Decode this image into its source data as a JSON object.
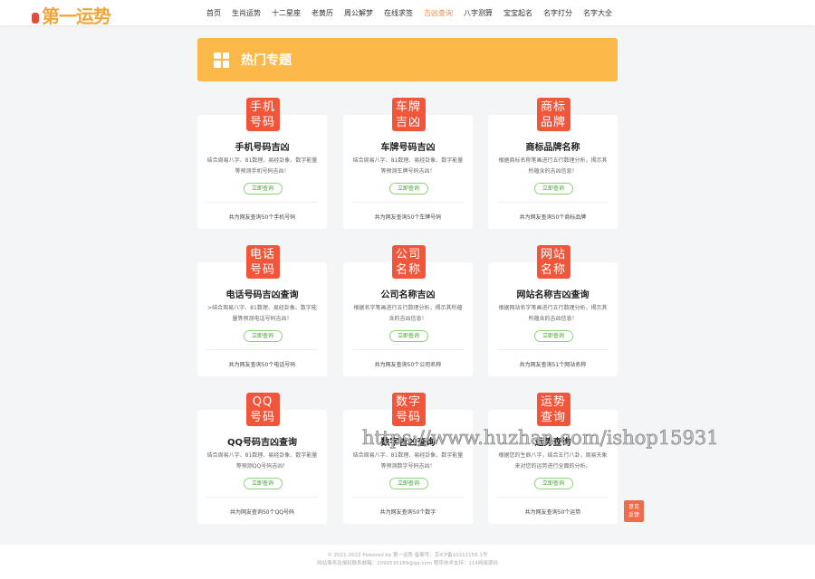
{
  "header": {
    "logo": "第一运势",
    "nav": [
      "首页",
      "生肖运势",
      "十二星座",
      "老黄历",
      "周公解梦",
      "在线求签",
      "吉凶查询",
      "八字测算",
      "宝宝起名",
      "名字打分",
      "名字大全"
    ],
    "active_index": 6
  },
  "banner": {
    "title": "热门专题"
  },
  "cards": [
    {
      "badge": [
        "手机",
        "号码"
      ],
      "title": "手机号码吉凶",
      "desc": "结合周易八字、81数理、易经卦象、数字能量等预测手机号码吉凶！",
      "button": "立即查询",
      "count": "共为网友查询50个手机号码"
    },
    {
      "badge": [
        "车牌",
        "吉凶"
      ],
      "title": "车牌号码吉凶",
      "desc": "结合周易八字、81数理、易经卦象、数字能量等预测车牌号码吉凶！",
      "button": "立即查询",
      "count": "共为网友查询50个车牌号码"
    },
    {
      "badge": [
        "商标",
        "品牌"
      ],
      "title": "商标品牌名称",
      "desc": "根据商标名称笔画进行五行数理分析，揭示其所蕴含的吉凶信息！",
      "button": "立即查询",
      "count": "共为网友查询50个商标品牌"
    },
    {
      "badge": [
        "电话",
        "号码"
      ],
      "title": "电话号码吉凶查询",
      "desc": ">结合周易八字、81数理、易经卦象、数字能量等预测电话号码吉凶！",
      "button": "立即查询",
      "count": "共为网友查询50个电话号码"
    },
    {
      "badge": [
        "公司",
        "名称"
      ],
      "title": "公司名称吉凶",
      "desc": "根据名字笔画进行五行数理分析，揭示其所蕴含的吉凶信息！",
      "button": "立即查询",
      "count": "共为网友查询50个公司名称"
    },
    {
      "badge": [
        "网站",
        "名称"
      ],
      "title": "网站名称吉凶查询",
      "desc": "根据网站名字笔画进行五行数理分析，揭示其所蕴含的吉凶信息！",
      "button": "立即查询",
      "count": "共为网友查询51个网站名称"
    },
    {
      "badge": [
        "QQ",
        "号码"
      ],
      "title": "QQ号码吉凶查询",
      "desc": "结合周易八字、81数理、易经卦象、数字能量等预测QQ号码吉凶！",
      "button": "立即查询",
      "count": "共为网友查询50个QQ号码"
    },
    {
      "badge": [
        "数字",
        "号码"
      ],
      "title": "数字吉凶查询",
      "desc": "结合周易八字、81数理、易经卦象、数字能量等预测数字号码吉凶！",
      "button": "立即查询",
      "count": "共为网友查询50个数字"
    },
    {
      "badge": [
        "运势",
        "查询"
      ],
      "title": "运势查询",
      "desc": "根据您的生辰八字，结合五行八卦，周易天象来对您的运势进行全面的分析。",
      "button": "立即查询",
      "count": "共为网友查询50个运势"
    }
  ],
  "feedback": [
    "意见",
    "反馈"
  ],
  "watermark": "https://www.huzhan.com/ishop15931",
  "footer": {
    "line1": "© 2021-2022 Powered by 第一运势 备案号：京ICP备10212156-1号",
    "line2": "网站事务及侵权联系邮箱：2090535189@qq.com 程序技术支持：114网络源码"
  },
  "colors": {
    "accent": "#f2563a",
    "banner": "#fdb84a",
    "button": "#3ea12b"
  }
}
